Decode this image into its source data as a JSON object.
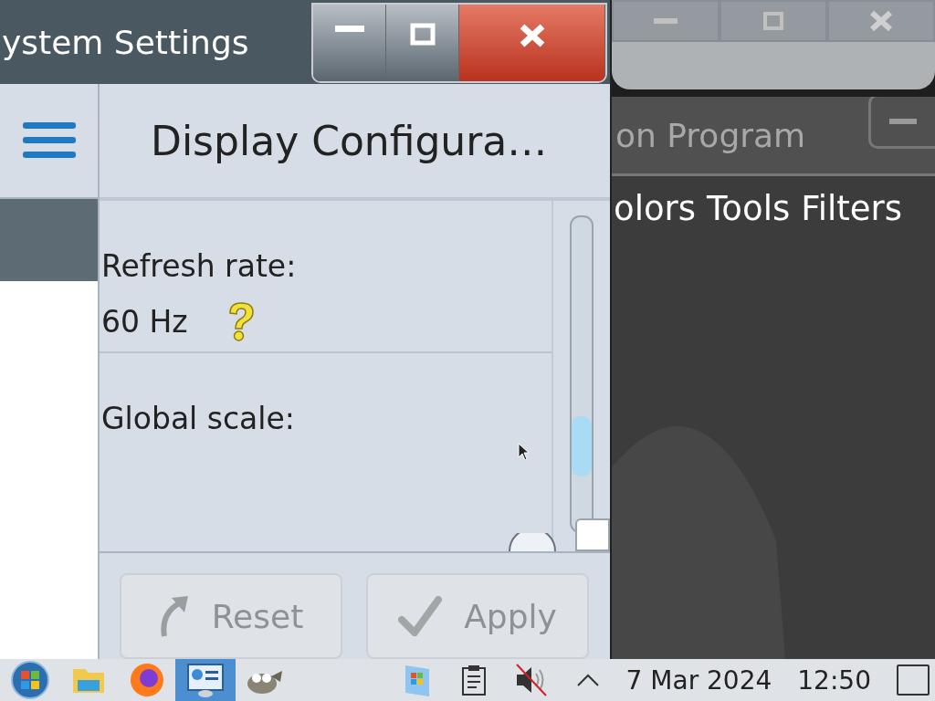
{
  "settings_window": {
    "title": "ystem Settings",
    "page_title": "Display Configura…",
    "sidebar": {
      "items": [
        {
          "kind": "menu"
        },
        {
          "kind": "item",
          "selected": true
        }
      ]
    },
    "fields": [
      {
        "label": "Refresh rate:",
        "value": "60 Hz",
        "help": true
      },
      {
        "label": "Global scale:",
        "help": false
      }
    ],
    "buttons": [
      {
        "label": "Reset",
        "kind": "reset",
        "disabled": true
      },
      {
        "label": "Apply",
        "kind": "apply",
        "disabled": true
      }
    ]
  },
  "background_window": {
    "title": "on Program",
    "menu": [
      "olors",
      "Tools",
      "Filters"
    ]
  },
  "taskbar": {
    "apps": [
      {
        "kind": "start",
        "selected": false
      },
      {
        "kind": "folder",
        "selected": false
      },
      {
        "kind": "browser",
        "selected": false
      },
      {
        "kind": "settings",
        "selected": true
      },
      {
        "kind": "gimp",
        "selected": false
      }
    ],
    "tray": [
      {
        "kind": "windows"
      },
      {
        "kind": "clipboard"
      },
      {
        "kind": "muted"
      },
      {
        "kind": "expand"
      }
    ],
    "date": "7 Mar 2024",
    "time": "12:50"
  }
}
